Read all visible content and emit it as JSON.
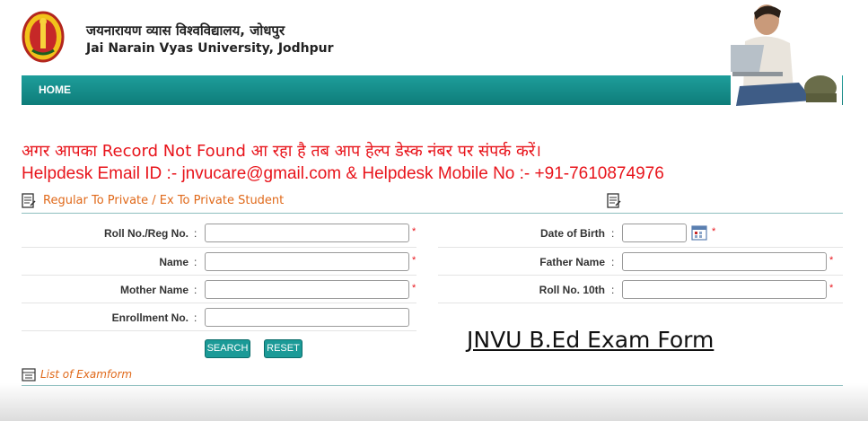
{
  "header": {
    "university_hindi": "जयनारायण व्यास विश्वविद्यालय, जोधपुर",
    "university_english": "Jai Narain Vyas University, Jodhpur"
  },
  "nav": {
    "home": "HOME"
  },
  "notice": {
    "line1": "अगर आपका Record Not Found आ रहा है तब आप हेल्प डेस्क नंबर पर संपर्क करें।",
    "line2": "Helpdesk Email ID :- jnvucare@gmail.com & Helpdesk Mobile No :- +91-7610874976"
  },
  "section": {
    "title": "Regular To Private / Ex To Private Student"
  },
  "form": {
    "colon": ":",
    "required": "*",
    "roll_label": "Roll No./Reg No.",
    "dob_label": "Date of Birth",
    "name_label": "Name",
    "father_label": "Father Name",
    "mother_label": "Mother Name",
    "roll10_label": "Roll No. 10th",
    "enroll_label": "Enrollment No.",
    "roll_value": "",
    "dob_value": "",
    "name_value": "",
    "father_value": "",
    "mother_value": "",
    "roll10_value": "",
    "enroll_value": ""
  },
  "buttons": {
    "search": "SEARCH",
    "reset": "RESET"
  },
  "watermark": "JNVU B.Ed Exam Form",
  "list": {
    "title": "List of Examform"
  },
  "colors": {
    "teal": "#1b9a97",
    "red": "#e8141b",
    "orange": "#e0691a"
  }
}
